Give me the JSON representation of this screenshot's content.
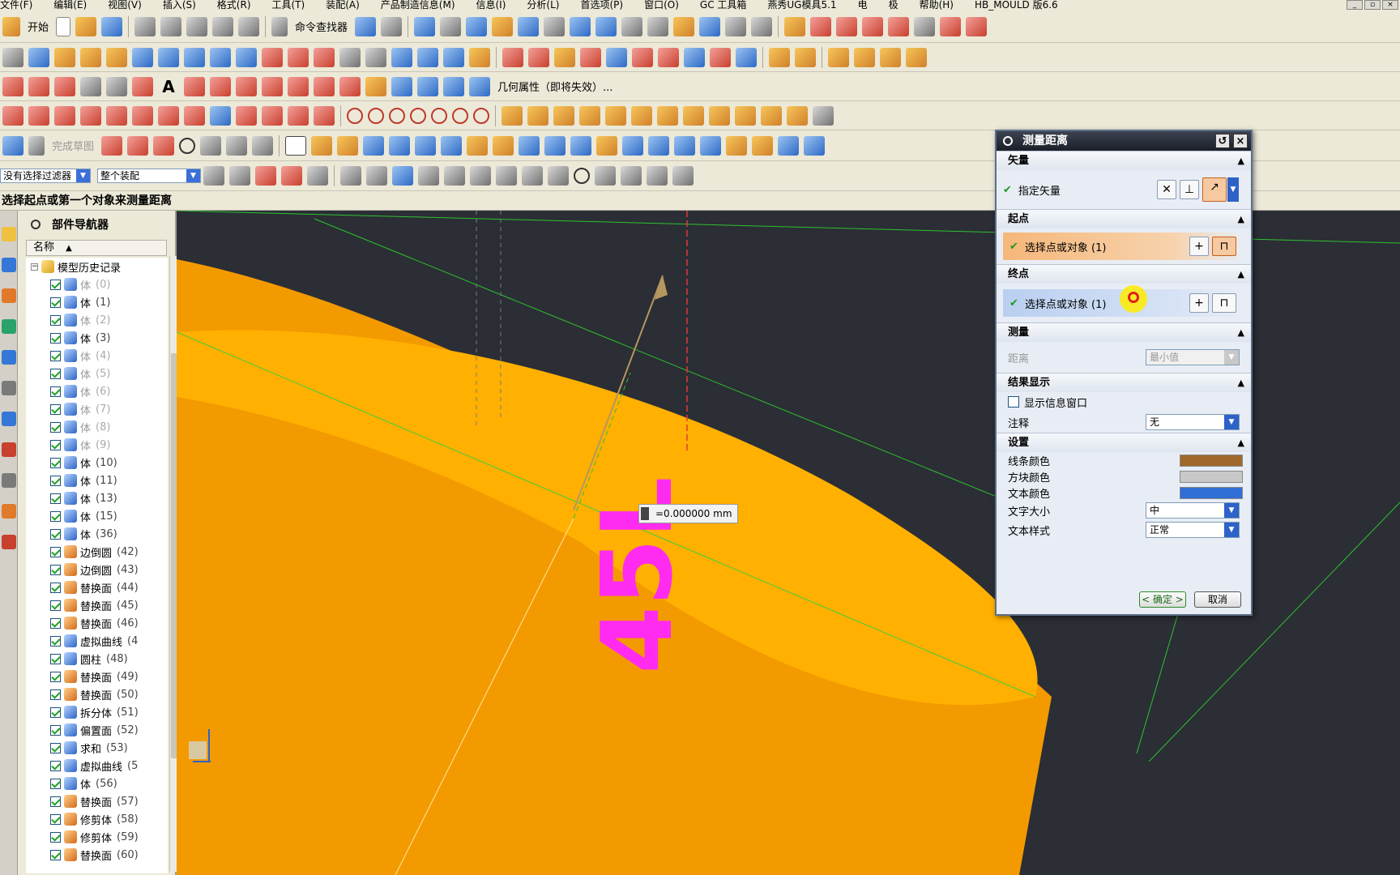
{
  "menubar": {
    "items": [
      "文件(F)",
      "编辑(E)",
      "视图(V)",
      "插入(S)",
      "格式(R)",
      "工具(T)",
      "装配(A)",
      "产品制造信息(M)",
      "信息(I)",
      "分析(L)",
      "首选项(P)",
      "窗口(O)",
      "GC 工具箱",
      "燕秀UG模具5.1",
      "电",
      "极",
      "帮助(H)",
      "HB_MOULD 版6.6"
    ]
  },
  "toolbar": {
    "start_label": "开始",
    "command_finder": "命令查找器",
    "geometry_properties": "几何属性（即将失效）...",
    "finish_sketch": "完成草图",
    "filter_select": "没有选择过滤器",
    "scope_select": "整个装配"
  },
  "cue_line": "选择起点或第一个对象来测量距离",
  "part_navigator": {
    "title": "部件导航器",
    "column_name": "名称",
    "root": "模型历史记录",
    "rows": [
      {
        "label": "体",
        "idx": "(0)",
        "dim": true,
        "icon": "body"
      },
      {
        "label": "体",
        "idx": "(1)",
        "dim": false,
        "icon": "body"
      },
      {
        "label": "体",
        "idx": "(2)",
        "dim": true,
        "icon": "body"
      },
      {
        "label": "体",
        "idx": "(3)",
        "dim": false,
        "icon": "body"
      },
      {
        "label": "体",
        "idx": "(4)",
        "dim": true,
        "icon": "body"
      },
      {
        "label": "体",
        "idx": "(5)",
        "dim": true,
        "icon": "body"
      },
      {
        "label": "体",
        "idx": "(6)",
        "dim": true,
        "icon": "body"
      },
      {
        "label": "体",
        "idx": "(7)",
        "dim": true,
        "icon": "body"
      },
      {
        "label": "体",
        "idx": "(8)",
        "dim": true,
        "icon": "body"
      },
      {
        "label": "体",
        "idx": "(9)",
        "dim": true,
        "icon": "body"
      },
      {
        "label": "体",
        "idx": "(10)",
        "dim": false,
        "icon": "body"
      },
      {
        "label": "体",
        "idx": "(11)",
        "dim": false,
        "icon": "body"
      },
      {
        "label": "体",
        "idx": "(13)",
        "dim": false,
        "icon": "body"
      },
      {
        "label": "体",
        "idx": "(15)",
        "dim": false,
        "icon": "body"
      },
      {
        "label": "体",
        "idx": "(36)",
        "dim": false,
        "icon": "body"
      },
      {
        "label": "边倒圆",
        "idx": "(42)",
        "dim": false,
        "icon": "blend"
      },
      {
        "label": "边倒圆",
        "idx": "(43)",
        "dim": false,
        "icon": "blend"
      },
      {
        "label": "替换面",
        "idx": "(44)",
        "dim": false,
        "icon": "face"
      },
      {
        "label": "替换面",
        "idx": "(45)",
        "dim": false,
        "icon": "face"
      },
      {
        "label": "替换面",
        "idx": "(46)",
        "dim": false,
        "icon": "face"
      },
      {
        "label": "虚拟曲线",
        "idx": "(4",
        "dim": false,
        "icon": "curve"
      },
      {
        "label": "圆柱",
        "idx": "(48)",
        "dim": false,
        "icon": "cyl"
      },
      {
        "label": "替换面",
        "idx": "(49)",
        "dim": false,
        "icon": "face"
      },
      {
        "label": "替换面",
        "idx": "(50)",
        "dim": false,
        "icon": "face"
      },
      {
        "label": "拆分体",
        "idx": "(51)",
        "dim": false,
        "icon": "split"
      },
      {
        "label": "偏置面",
        "idx": "(52)",
        "dim": false,
        "icon": "offset"
      },
      {
        "label": "求和",
        "idx": "(53)",
        "dim": false,
        "icon": "unite"
      },
      {
        "label": "虚拟曲线",
        "idx": "(5",
        "dim": false,
        "icon": "curve"
      },
      {
        "label": "体",
        "idx": "(56)",
        "dim": false,
        "icon": "body"
      },
      {
        "label": "替换面",
        "idx": "(57)",
        "dim": false,
        "icon": "face"
      },
      {
        "label": "修剪体",
        "idx": "(58)",
        "dim": false,
        "icon": "trim"
      },
      {
        "label": "修剪体",
        "idx": "(59)",
        "dim": false,
        "icon": "trim"
      },
      {
        "label": "替换面",
        "idx": "(60)",
        "dim": false,
        "icon": "face"
      }
    ]
  },
  "viewport": {
    "annotation_text": "45L",
    "measure_readout": "=0.000000 mm",
    "colors": {
      "background": "#2b2e35",
      "cylinder_top": "#ffb000",
      "cylinder_side": "#f39a00",
      "annotation": "#ff2bf0",
      "wire": "#33cc33"
    }
  },
  "dialog": {
    "title": "测量距离",
    "sections": {
      "vector": "矢量",
      "start": "起点",
      "end": "终点",
      "measure": "测量",
      "result": "结果显示",
      "settings": "设置"
    },
    "specify_vector": "指定矢量",
    "start_select": "选择点或对象 (1)",
    "end_select": "选择点或对象 (1)",
    "distance_label": "距离",
    "distance_value": "最小值",
    "show_info_window": "显示信息窗口",
    "annotation_label": "注释",
    "annotation_value": "无",
    "line_color_label": "线条颜色",
    "block_color_label": "方块颜色",
    "text_color_label": "文本颜色",
    "text_size_label": "文字大小",
    "text_size_value": "中",
    "text_style_label": "文本样式",
    "text_style_value": "正常",
    "ok": "< 确定 >",
    "cancel": "取消",
    "colors": {
      "line": "#a0682c",
      "block": "#c8c8c8",
      "text": "#2f6fd6"
    }
  }
}
